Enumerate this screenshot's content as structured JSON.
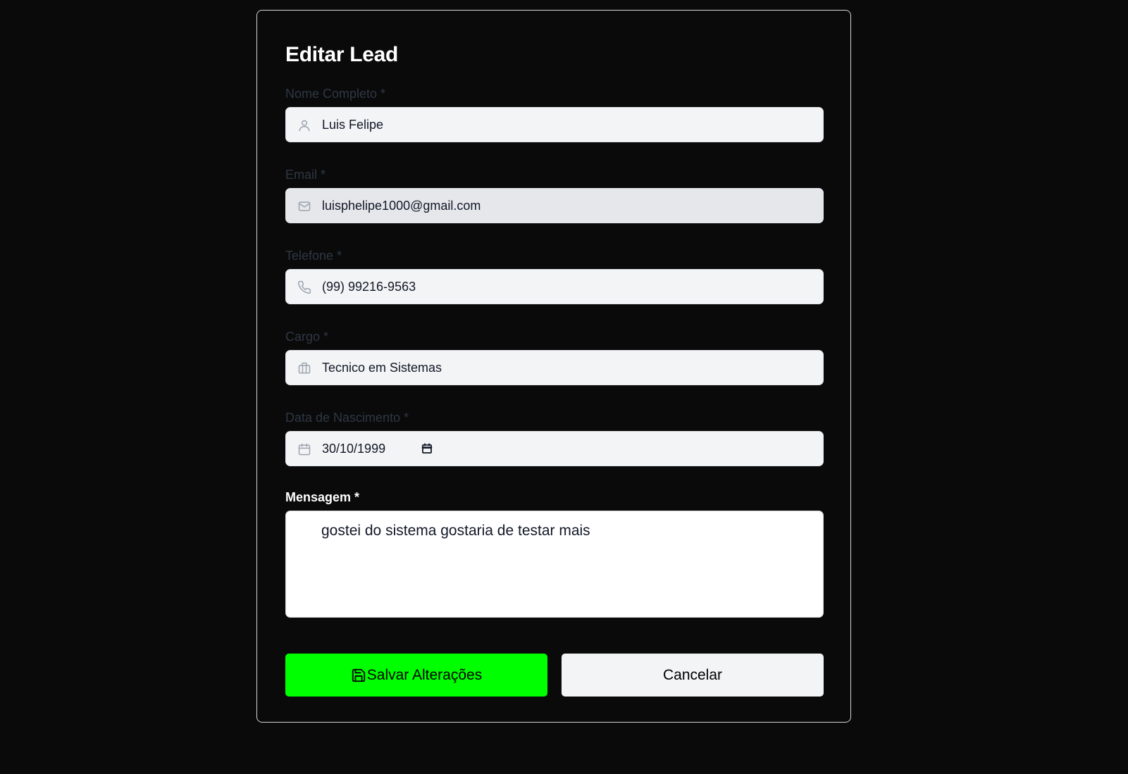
{
  "form": {
    "title": "Editar Lead",
    "fields": {
      "name": {
        "label": "Nome Completo *",
        "value": "Luis Felipe",
        "icon": "user-icon"
      },
      "email": {
        "label": "Email *",
        "value": "luisphelipe1000@gmail.com",
        "icon": "mail-icon"
      },
      "phone": {
        "label": "Telefone *",
        "value": "(99) 99216-9563",
        "icon": "phone-icon"
      },
      "role": {
        "label": "Cargo *",
        "value": "Tecnico em Sistemas",
        "icon": "briefcase-icon"
      },
      "birth": {
        "label": "Data de Nascimento *",
        "value": "30/10/1999",
        "icon": "calendar-icon"
      },
      "message": {
        "label": "Mensagem *",
        "value": "gostei do sistema gostaria de testar mais"
      }
    },
    "buttons": {
      "save_label": "Salvar Alterações",
      "cancel_label": "Cancelar"
    }
  },
  "colors": {
    "background": "#0a0a0a",
    "save_button": "#00ff00",
    "input_background": "#f3f4f6",
    "muted_label": "#2f3744"
  }
}
